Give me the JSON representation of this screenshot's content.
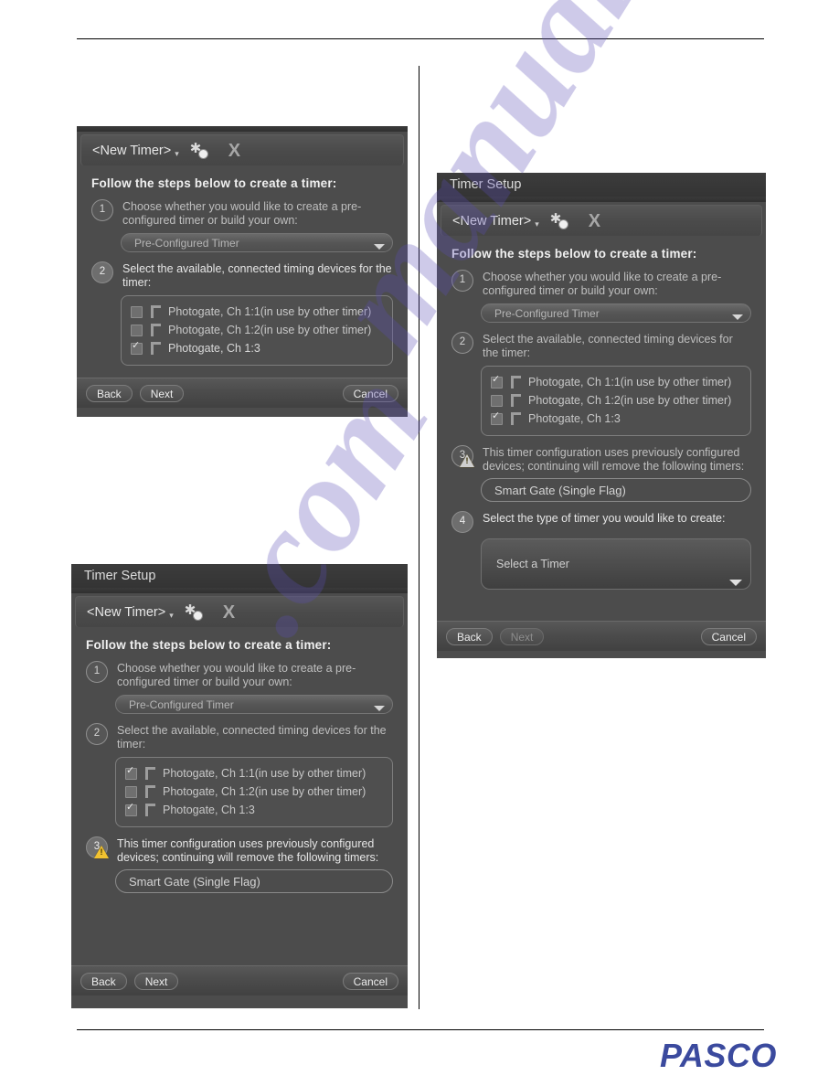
{
  "page": {
    "logo_text": "PASCO"
  },
  "watermark": {
    "line1": "manualshlve",
    "line2": ".com"
  },
  "common": {
    "window_title": "Timer Setup",
    "tab_title": "<New Timer>",
    "tab_caret": "▾",
    "spark_icon": "new-timer-icon",
    "close_icon": "X",
    "heading": "Follow the steps below to create a timer:",
    "step1_number": "1",
    "step1_text": "Choose whether you would like to create a pre-configured timer or build your own:",
    "step1_value": "Pre-Configured Timer",
    "step2_number": "2",
    "step2_text": "Select the available, connected timing devices for the timer:",
    "step3_number": "3",
    "step3_text": "This timer configuration uses previously configured devices; continuing will remove the following timers:",
    "step3_value": "Smart Gate (Single Flag)",
    "step4_number": "4",
    "step4_text": "Select the type of timer you would like to create:",
    "step4_value": "Select a Timer",
    "btn_back": "Back",
    "btn_next": "Next",
    "btn_cancel": "Cancel",
    "device1": "Photogate, Ch 1:1(in use by other timer)",
    "device2": "Photogate, Ch 1:2(in use by other timer)",
    "device3": "Photogate, Ch 1:3"
  },
  "dialog_topleft": {
    "devices": [
      {
        "label": "Photogate, Ch 1:1(in use by other timer)",
        "checked": false
      },
      {
        "label": "Photogate, Ch 1:2(in use by other timer)",
        "checked": false
      },
      {
        "label": "Photogate, Ch 1:3",
        "checked": true
      }
    ]
  },
  "dialog_bottomleft": {
    "devices": [
      {
        "label": "Photogate, Ch 1:1(in use by other timer)",
        "checked": true
      },
      {
        "label": "Photogate, Ch 1:2(in use by other timer)",
        "checked": false
      },
      {
        "label": "Photogate, Ch 1:3",
        "checked": true
      }
    ]
  },
  "dialog_right": {
    "devices": [
      {
        "label": "Photogate, Ch 1:1(in use by other timer)",
        "checked": true
      },
      {
        "label": "Photogate, Ch 1:2(in use by other timer)",
        "checked": false
      },
      {
        "label": "Photogate, Ch 1:3",
        "checked": true
      }
    ]
  },
  "colors": {
    "dialog_bg": "#4c4c4c",
    "titlebar_bg": "#3a3a3a",
    "logo_blue": "#3b4a9e",
    "warning_yellow": "#f2c230"
  }
}
